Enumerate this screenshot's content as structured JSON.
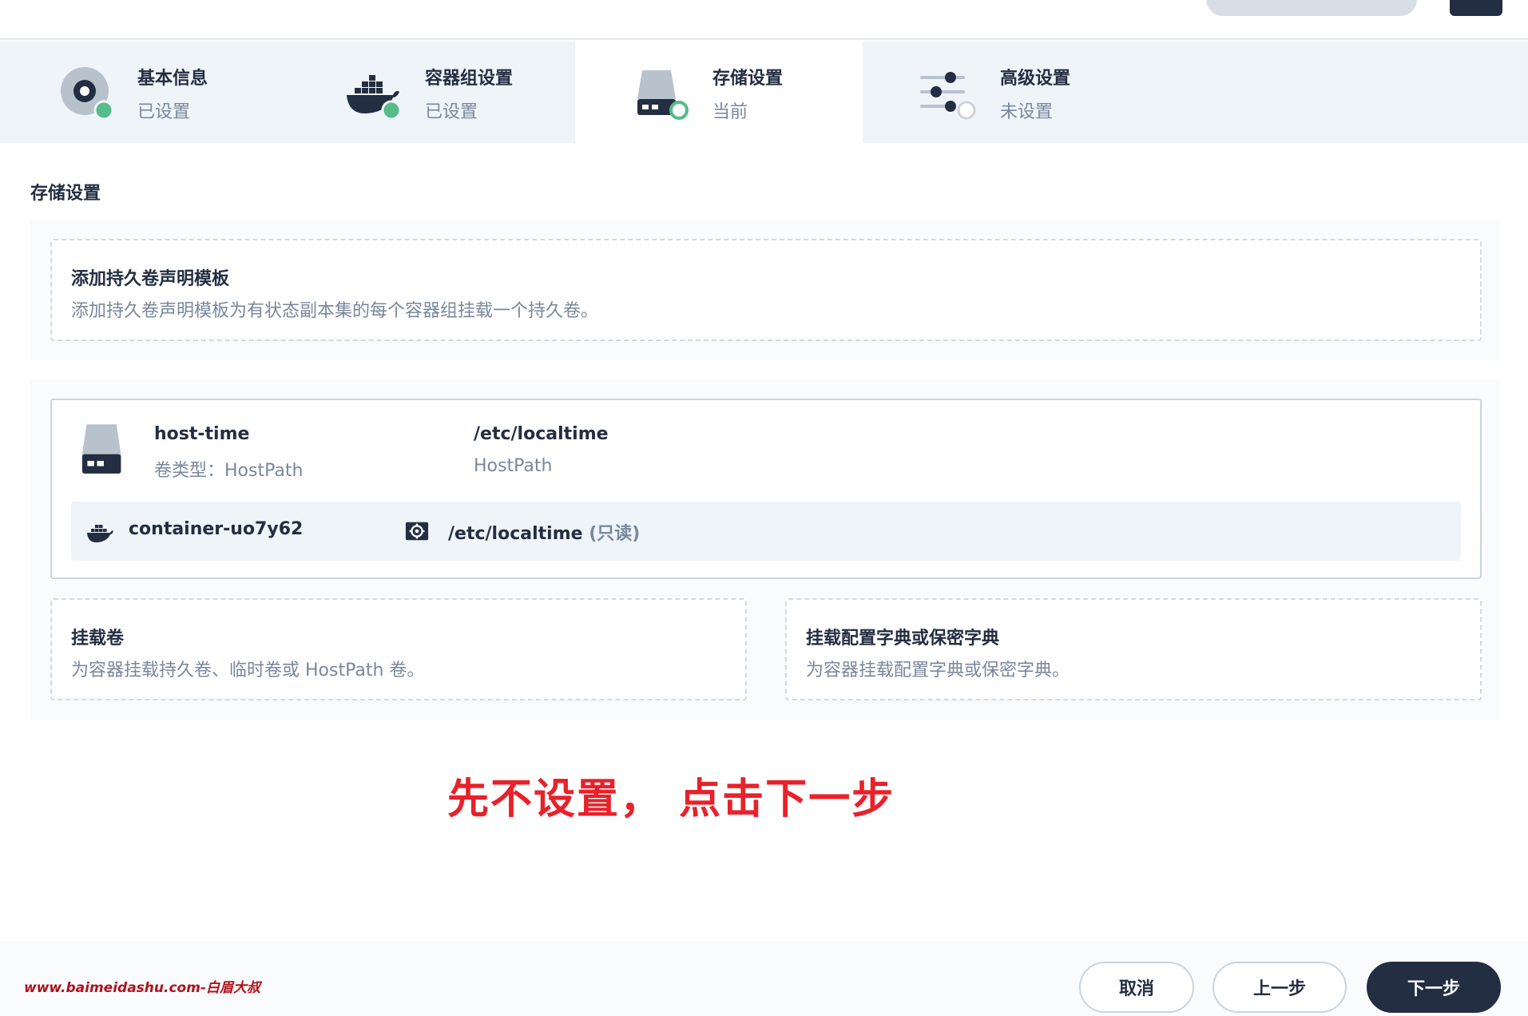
{
  "steps": [
    {
      "title": "基本信息",
      "status": "已设置",
      "icon": "disc-icon",
      "state": "done"
    },
    {
      "title": "容器组设置",
      "status": "已设置",
      "icon": "docker-icon",
      "state": "done"
    },
    {
      "title": "存储设置",
      "status": "当前",
      "icon": "storage-icon",
      "state": "current"
    },
    {
      "title": "高级设置",
      "status": "未设置",
      "icon": "sliders-icon",
      "state": "pending"
    }
  ],
  "section": {
    "title": "存储设置"
  },
  "pvc_template": {
    "title": "添加持久卷声明模板",
    "desc": "添加持久卷声明模板为有状态副本集的每个容器组挂载一个持久卷。"
  },
  "volume": {
    "name": "host-time",
    "type_label": "卷类型：HostPath",
    "path": "/etc/localtime",
    "path_sub": "HostPath",
    "mount": {
      "container": "container-uo7y62",
      "path": "/etc/localtime",
      "mode": "(只读)"
    }
  },
  "mount_volume": {
    "title": "挂载卷",
    "desc": "为容器挂载持久卷、临时卷或 HostPath 卷。"
  },
  "mount_config": {
    "title": "挂载配置字典或保密字典",
    "desc": "为容器挂载配置字典或保密字典。"
  },
  "annotation": "先不设置， 点击下一步",
  "watermark": "www.baimeidashu.com-白眉大叔",
  "buttons": {
    "cancel": "取消",
    "prev": "上一步",
    "next": "下一步"
  },
  "colors": {
    "dark": "#242e42",
    "muted": "#79879c",
    "green": "#55bc8a",
    "annotation": "#e8212a"
  }
}
